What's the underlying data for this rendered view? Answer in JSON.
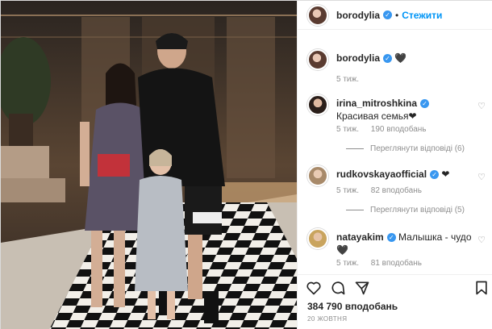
{
  "post": {
    "author": "borodylia",
    "follow_label": "Стежити",
    "caption": "🖤",
    "caption_time": "5 тиж."
  },
  "comments": [
    {
      "username": "irina_mitroshkina",
      "text": "Красивая семья❤",
      "time": "5 тиж.",
      "likes": "190 вподобань",
      "replies": "Переглянути відповіді (6)"
    },
    {
      "username": "rudkovskayaofficial",
      "text": "❤",
      "time": "5 тиж.",
      "likes": "82 вподобань",
      "replies": "Переглянути відповіді (5)"
    },
    {
      "username": "natayakim",
      "text": "Малышка - чудо 🖤",
      "time": "5 тиж.",
      "likes": "81 вподобань",
      "replies": ""
    }
  ],
  "footer": {
    "likes": "384 790 вподобань",
    "date": "20 ЖОВТНЯ"
  },
  "icons": {
    "like": "heart-icon",
    "comment": "comment-icon",
    "share": "share-icon",
    "save": "bookmark-icon"
  },
  "colors": {
    "accent": "#0095f6",
    "verified": "#3897f0",
    "muted": "#8e8e8e"
  }
}
